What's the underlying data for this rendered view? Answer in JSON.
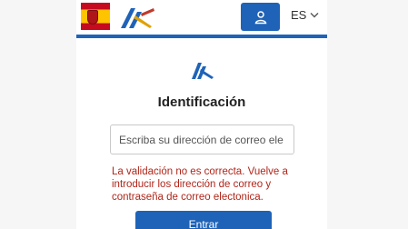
{
  "header": {
    "flag_icon": "spain-flag-icon",
    "logo_icon": "agencia-tributaria-logo-icon",
    "user_icon": "user-icon",
    "language": "ES",
    "language_icon": "chevron-down-icon"
  },
  "form": {
    "logo_icon": "agencia-tributaria-logo-icon",
    "title": "Identificación",
    "email_placeholder": "Escriba su dirección de correo ele",
    "error_message": "La validación no es correcta. Vuelve a introducir los dirección de correo y contraseña de correo electonica.",
    "submit_label": "Entrar"
  },
  "colors": {
    "primary": "#1e63b8",
    "error": "#b0261a"
  }
}
